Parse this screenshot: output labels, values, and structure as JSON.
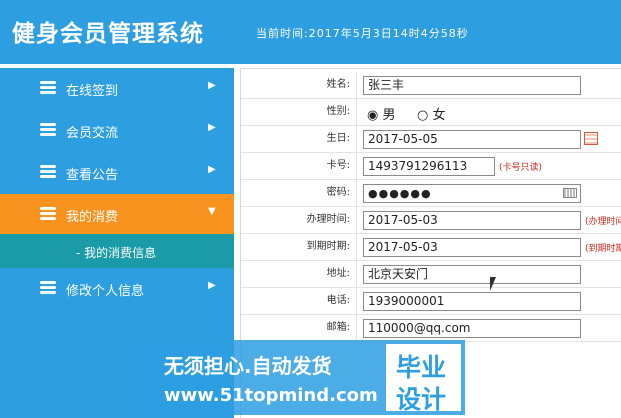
{
  "header": {
    "title": "健身会员管理系统",
    "time": "当前时间:2017年5月3日14时4分58秒"
  },
  "sidebar": {
    "items": [
      {
        "label": "在线签到",
        "arrow": "▶"
      },
      {
        "label": "会员交流",
        "arrow": "▶"
      },
      {
        "label": "查看公告",
        "arrow": "▶"
      },
      {
        "label": "我的消费",
        "arrow": "▼"
      },
      {
        "label": "修改个人信息",
        "arrow": "▶"
      }
    ],
    "active_item": "我的消费",
    "sub_item": "- 我的消费信息"
  },
  "form": {
    "name_label": "姓名:",
    "name_value": "张三丰",
    "gender_label": "性别:",
    "gender_male": "男",
    "gender_female": "女",
    "gender_selected": "男",
    "birthday_label": "生日:",
    "birthday_value": "2017-05-05",
    "card_label": "卡号:",
    "card_value": "1493791296113",
    "card_hint": "(卡号只读)",
    "password_label": "密码:",
    "password_value": "●●●●●●",
    "start_label": "办理时间:",
    "start_value": "2017-05-03",
    "start_hint": "(办理时间",
    "end_label": "到期时期:",
    "end_value": "2017-05-03",
    "end_hint": "(到期时期",
    "address_label": "地址:",
    "address_value": "北京天安门",
    "phone_label": "电话:",
    "phone_value": "1939000001",
    "email_label": "邮箱:",
    "email_value": "110000@qq.com"
  },
  "watermark": {
    "line1": "无须担心.自动发货",
    "line2": "www.51topmind.com",
    "box_line1": "毕业",
    "box_line2": "设计"
  },
  "colors": {
    "primary": "#2d9ee0",
    "active": "#f7931e",
    "submenu": "#1b9ba7",
    "hint": "#d0281a"
  }
}
